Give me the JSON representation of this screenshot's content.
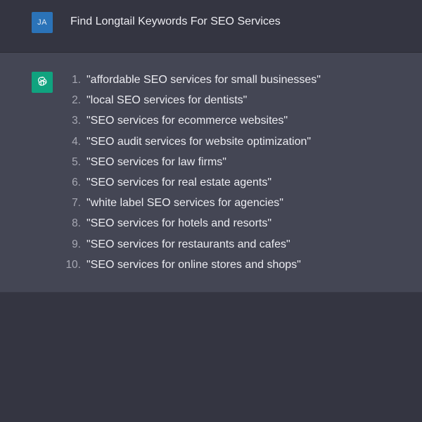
{
  "user": {
    "avatar_initials": "JA",
    "avatar_color": "#2b73b8",
    "message": "Find Longtail Keywords For SEO Services"
  },
  "assistant": {
    "avatar_icon": "openai-logo-icon",
    "avatar_color": "#10a37f",
    "items": [
      {
        "num": "1.",
        "text": "\"affordable SEO services for small businesses\""
      },
      {
        "num": "2.",
        "text": "\"local SEO services for dentists\""
      },
      {
        "num": "3.",
        "text": "\"SEO services for ecommerce websites\""
      },
      {
        "num": "4.",
        "text": "\"SEO audit services for website optimization\""
      },
      {
        "num": "5.",
        "text": "\"SEO services for law firms\""
      },
      {
        "num": "6.",
        "text": "\"SEO services for real estate agents\""
      },
      {
        "num": "7.",
        "text": "\"white label SEO services for agencies\""
      },
      {
        "num": "8.",
        "text": "\"SEO services for hotels and resorts\""
      },
      {
        "num": "9.",
        "text": "\"SEO services for restaurants and cafes\""
      },
      {
        "num": "10.",
        "text": "\"SEO services for online stores and shops\""
      }
    ]
  },
  "colors": {
    "background": "#343541",
    "assistant_background": "#444654",
    "text": "#ececf1"
  }
}
